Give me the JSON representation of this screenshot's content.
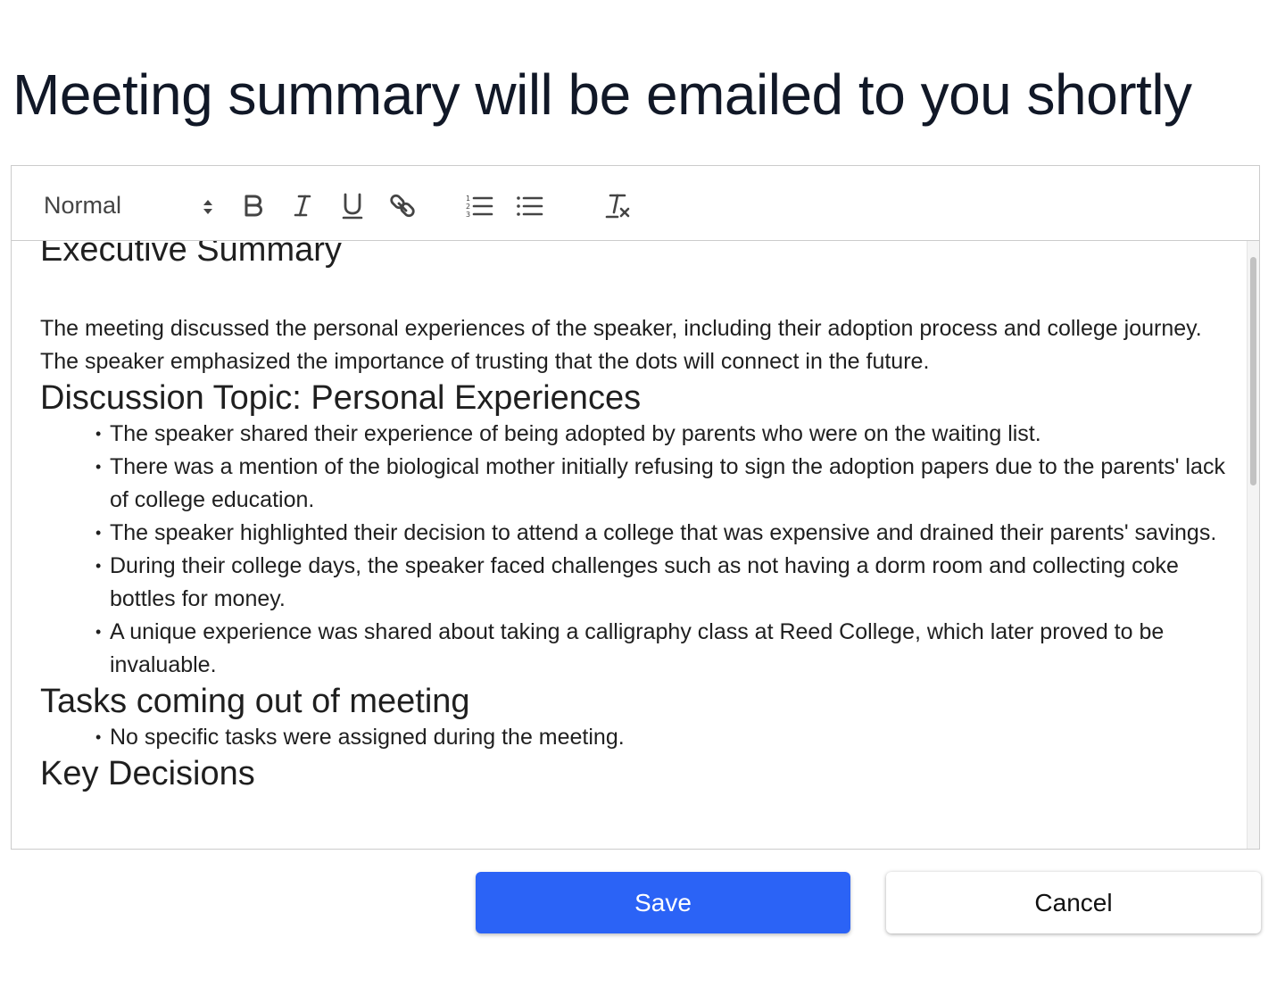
{
  "header": {
    "title": "Meeting summary will be emailed to you shortly"
  },
  "toolbar": {
    "format_select": "Normal",
    "icons": [
      "bold-icon",
      "italic-icon",
      "underline-icon",
      "link-icon",
      "ordered-list-icon",
      "bullet-list-icon",
      "clear-format-icon"
    ]
  },
  "document": {
    "executive_heading": "Executive Summary",
    "executive_text": "The meeting discussed the personal experiences of the speaker, including their adoption process and college journey. The speaker emphasized the importance of trusting that the dots will connect in the future.",
    "topic_heading": "Discussion Topic: Personal Experiences",
    "topic_items": [
      "The speaker shared their experience of being adopted by parents who were on the waiting list.",
      "There was a mention of the biological mother initially refusing to sign the adoption papers due to the parents' lack of college education.",
      "The speaker highlighted their decision to attend a college that was expensive and drained their parents' savings.",
      "During their college days, the speaker faced challenges such as not having a dorm room and collecting coke bottles for money.",
      "A unique experience was shared about taking a calligraphy class at Reed College, which later proved to be invaluable."
    ],
    "tasks_heading": "Tasks coming out of meeting",
    "tasks_items": [
      "No specific tasks were assigned during the meeting."
    ],
    "decisions_heading": "Key Decisions"
  },
  "actions": {
    "save_label": "Save",
    "cancel_label": "Cancel"
  },
  "colors": {
    "primary": "#2b63f6",
    "title_text": "#111827",
    "border": "#cccccc"
  }
}
